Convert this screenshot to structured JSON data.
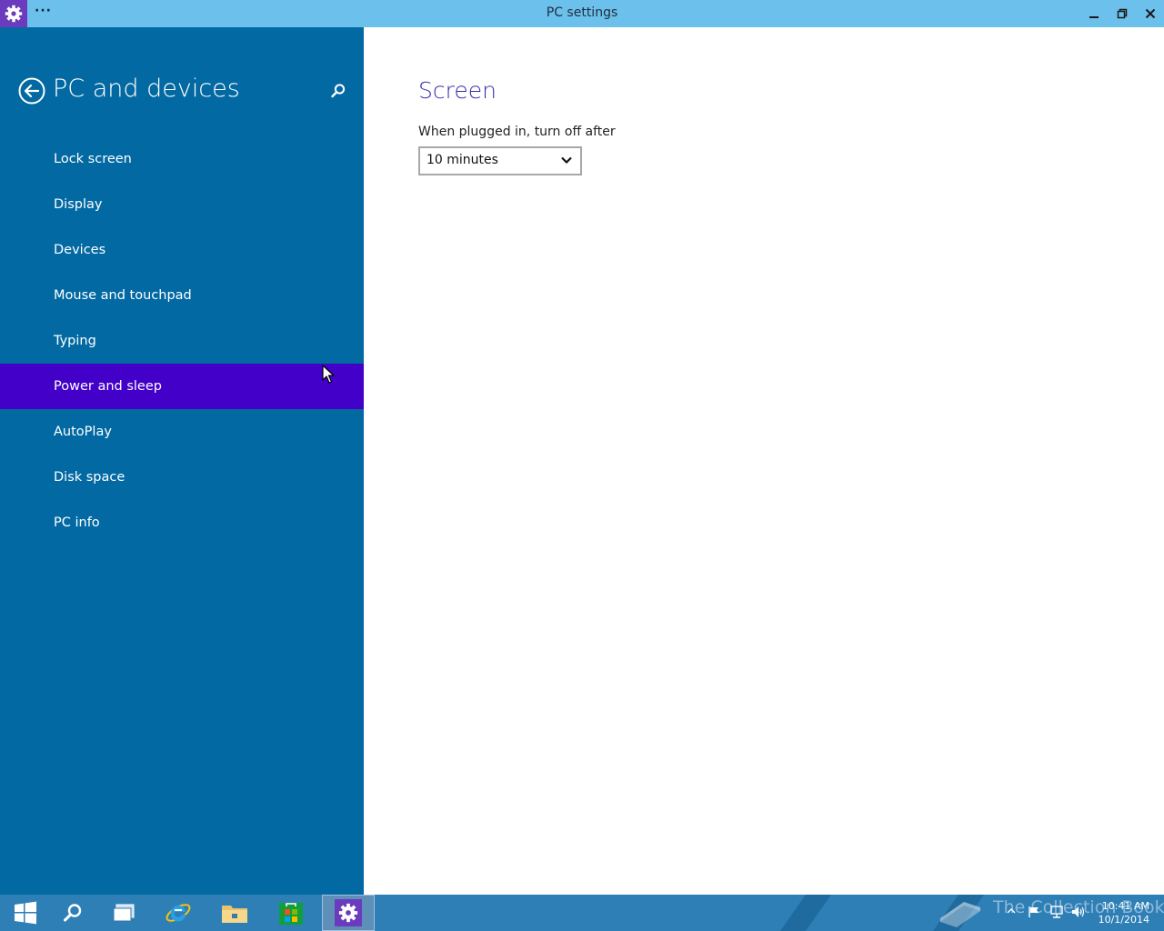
{
  "window": {
    "title": "PC settings",
    "menu_label": "···",
    "accent": "#6a3cbd"
  },
  "sidebar": {
    "title": "PC and devices",
    "background": "#0269a3",
    "selected_color": "#4300c8",
    "items": [
      {
        "label": "Lock screen"
      },
      {
        "label": "Display"
      },
      {
        "label": "Devices"
      },
      {
        "label": "Mouse and touchpad"
      },
      {
        "label": "Typing"
      },
      {
        "label": "Power and sleep",
        "selected": true
      },
      {
        "label": "AutoPlay"
      },
      {
        "label": "Disk space"
      },
      {
        "label": "PC info"
      }
    ]
  },
  "main": {
    "section_title": "Screen",
    "setting_label": "When plugged in, turn off after",
    "setting_value": "10 minutes"
  },
  "taskbar": {
    "apps": [
      "start-icon",
      "search-icon",
      "task-view-icon",
      "internet-explorer-icon",
      "file-explorer-icon",
      "store-icon",
      "settings-icon"
    ],
    "active_app": "settings-icon",
    "watermark": "The Collection Book",
    "clock": {
      "time": "10:41 AM",
      "date": "10/1/2014"
    }
  }
}
